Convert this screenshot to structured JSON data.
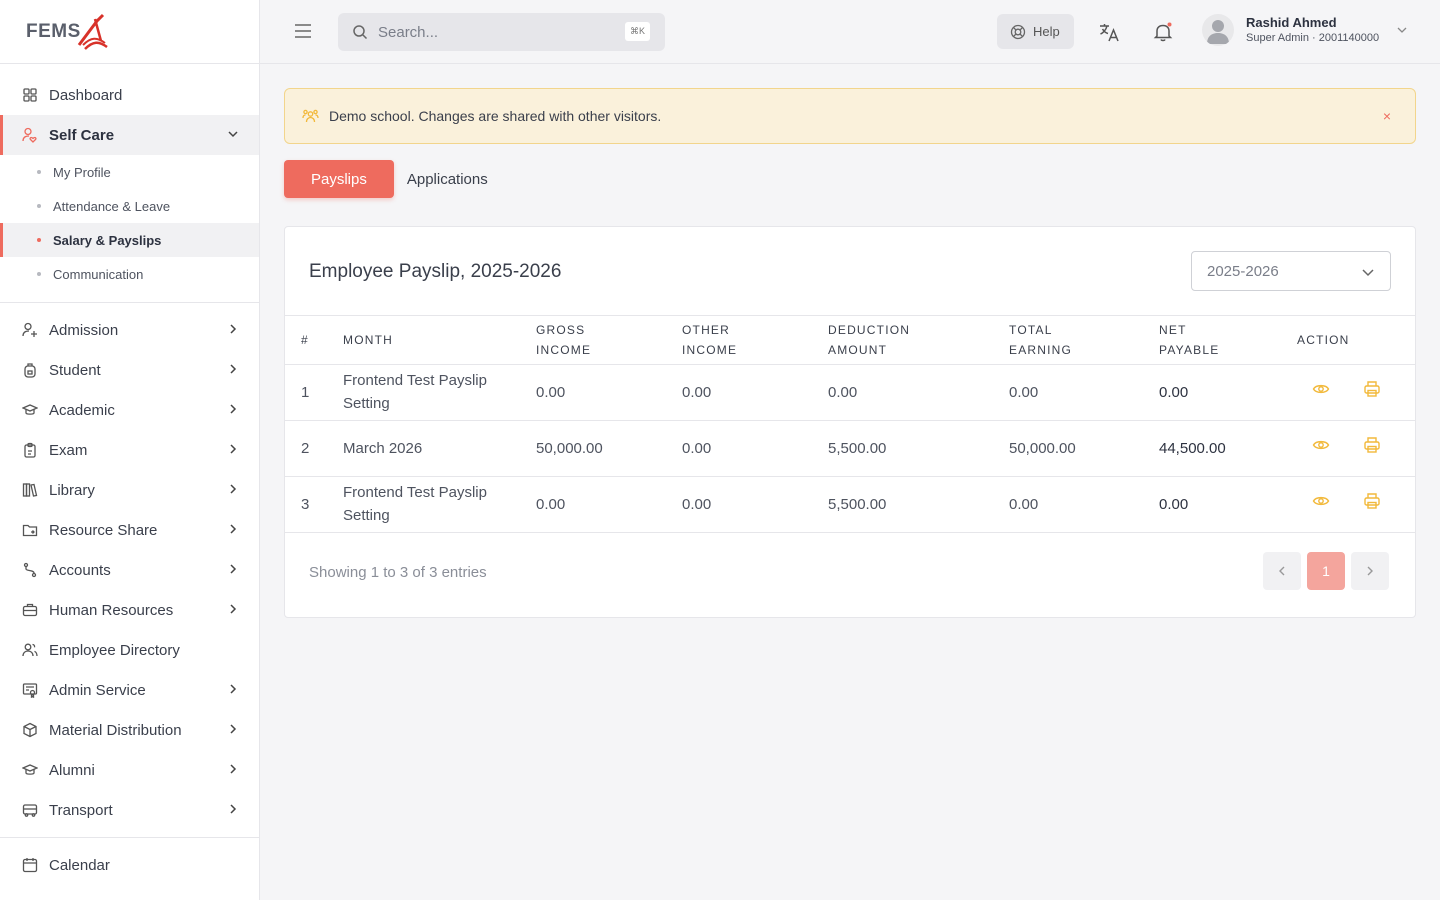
{
  "brand": {
    "logo_text": "FEMS"
  },
  "sidebar": {
    "top": [
      {
        "label": "Dashboard",
        "icon": "grid-icon"
      }
    ],
    "self_care": {
      "label": "Self Care",
      "icon": "user-heart-icon",
      "sub": [
        {
          "label": "My Profile"
        },
        {
          "label": "Attendance & Leave"
        },
        {
          "label": "Salary & Payslips"
        },
        {
          "label": "Communication"
        }
      ]
    },
    "main": [
      {
        "label": "Admission",
        "icon": "user-plus-icon"
      },
      {
        "label": "Student",
        "icon": "backpack-icon"
      },
      {
        "label": "Academic",
        "icon": "graduation-cap-icon"
      },
      {
        "label": "Exam",
        "icon": "clipboard-icon"
      },
      {
        "label": "Library",
        "icon": "books-icon"
      },
      {
        "label": "Resource Share",
        "icon": "folder-share-icon"
      },
      {
        "label": "Accounts",
        "icon": "route-icon"
      },
      {
        "label": "Human Resources",
        "icon": "briefcase-icon"
      },
      {
        "label": "Employee Directory",
        "icon": "users-icon"
      },
      {
        "label": "Admin Service",
        "icon": "certificate-icon"
      },
      {
        "label": "Material Distribution",
        "icon": "package-icon"
      },
      {
        "label": "Alumni",
        "icon": "graduation-cap-icon"
      },
      {
        "label": "Transport",
        "icon": "bus-icon"
      }
    ],
    "bottom": [
      {
        "label": "Calendar",
        "icon": "calendar-icon"
      }
    ]
  },
  "header": {
    "search_placeholder": "Search...",
    "search_shortcut": "⌘K",
    "help_label": "Help",
    "user_name": "Rashid Ahmed",
    "user_role": "Super Admin · 2001140000"
  },
  "alert": {
    "message": "Demo school. Changes are shared with other visitors.",
    "close": "×"
  },
  "tabs": [
    {
      "label": "Payslips"
    },
    {
      "label": "Applications"
    }
  ],
  "card": {
    "title": "Employee Payslip, 2025-2026",
    "year_selected": "2025-2026",
    "columns": [
      "#",
      "MONTH",
      "GROSS INCOME",
      "OTHER INCOME",
      "DEDUCTION AMOUNT",
      "TOTAL EARNING",
      "NET PAYABLE",
      "ACTION"
    ],
    "rows": [
      {
        "no": "1",
        "month": "Frontend Test Payslip Setting",
        "gross": "0.00",
        "other": "0.00",
        "deduction": "0.00",
        "total": "0.00",
        "net": "0.00"
      },
      {
        "no": "2",
        "month": "March 2026",
        "gross": "50,000.00",
        "other": "0.00",
        "deduction": "5,500.00",
        "total": "50,000.00",
        "net": "44,500.00"
      },
      {
        "no": "3",
        "month": "Frontend Test Payslip Setting",
        "gross": "0.00",
        "other": "0.00",
        "deduction": "5,500.00",
        "total": "0.00",
        "net": "0.00"
      }
    ],
    "entries_text": "Showing 1 to 3 of 3 entries",
    "current_page": "1"
  },
  "colors": {
    "accent": "#ee6b5e",
    "action_icon": "#f2b93b",
    "alert_bg": "#faf1db"
  }
}
